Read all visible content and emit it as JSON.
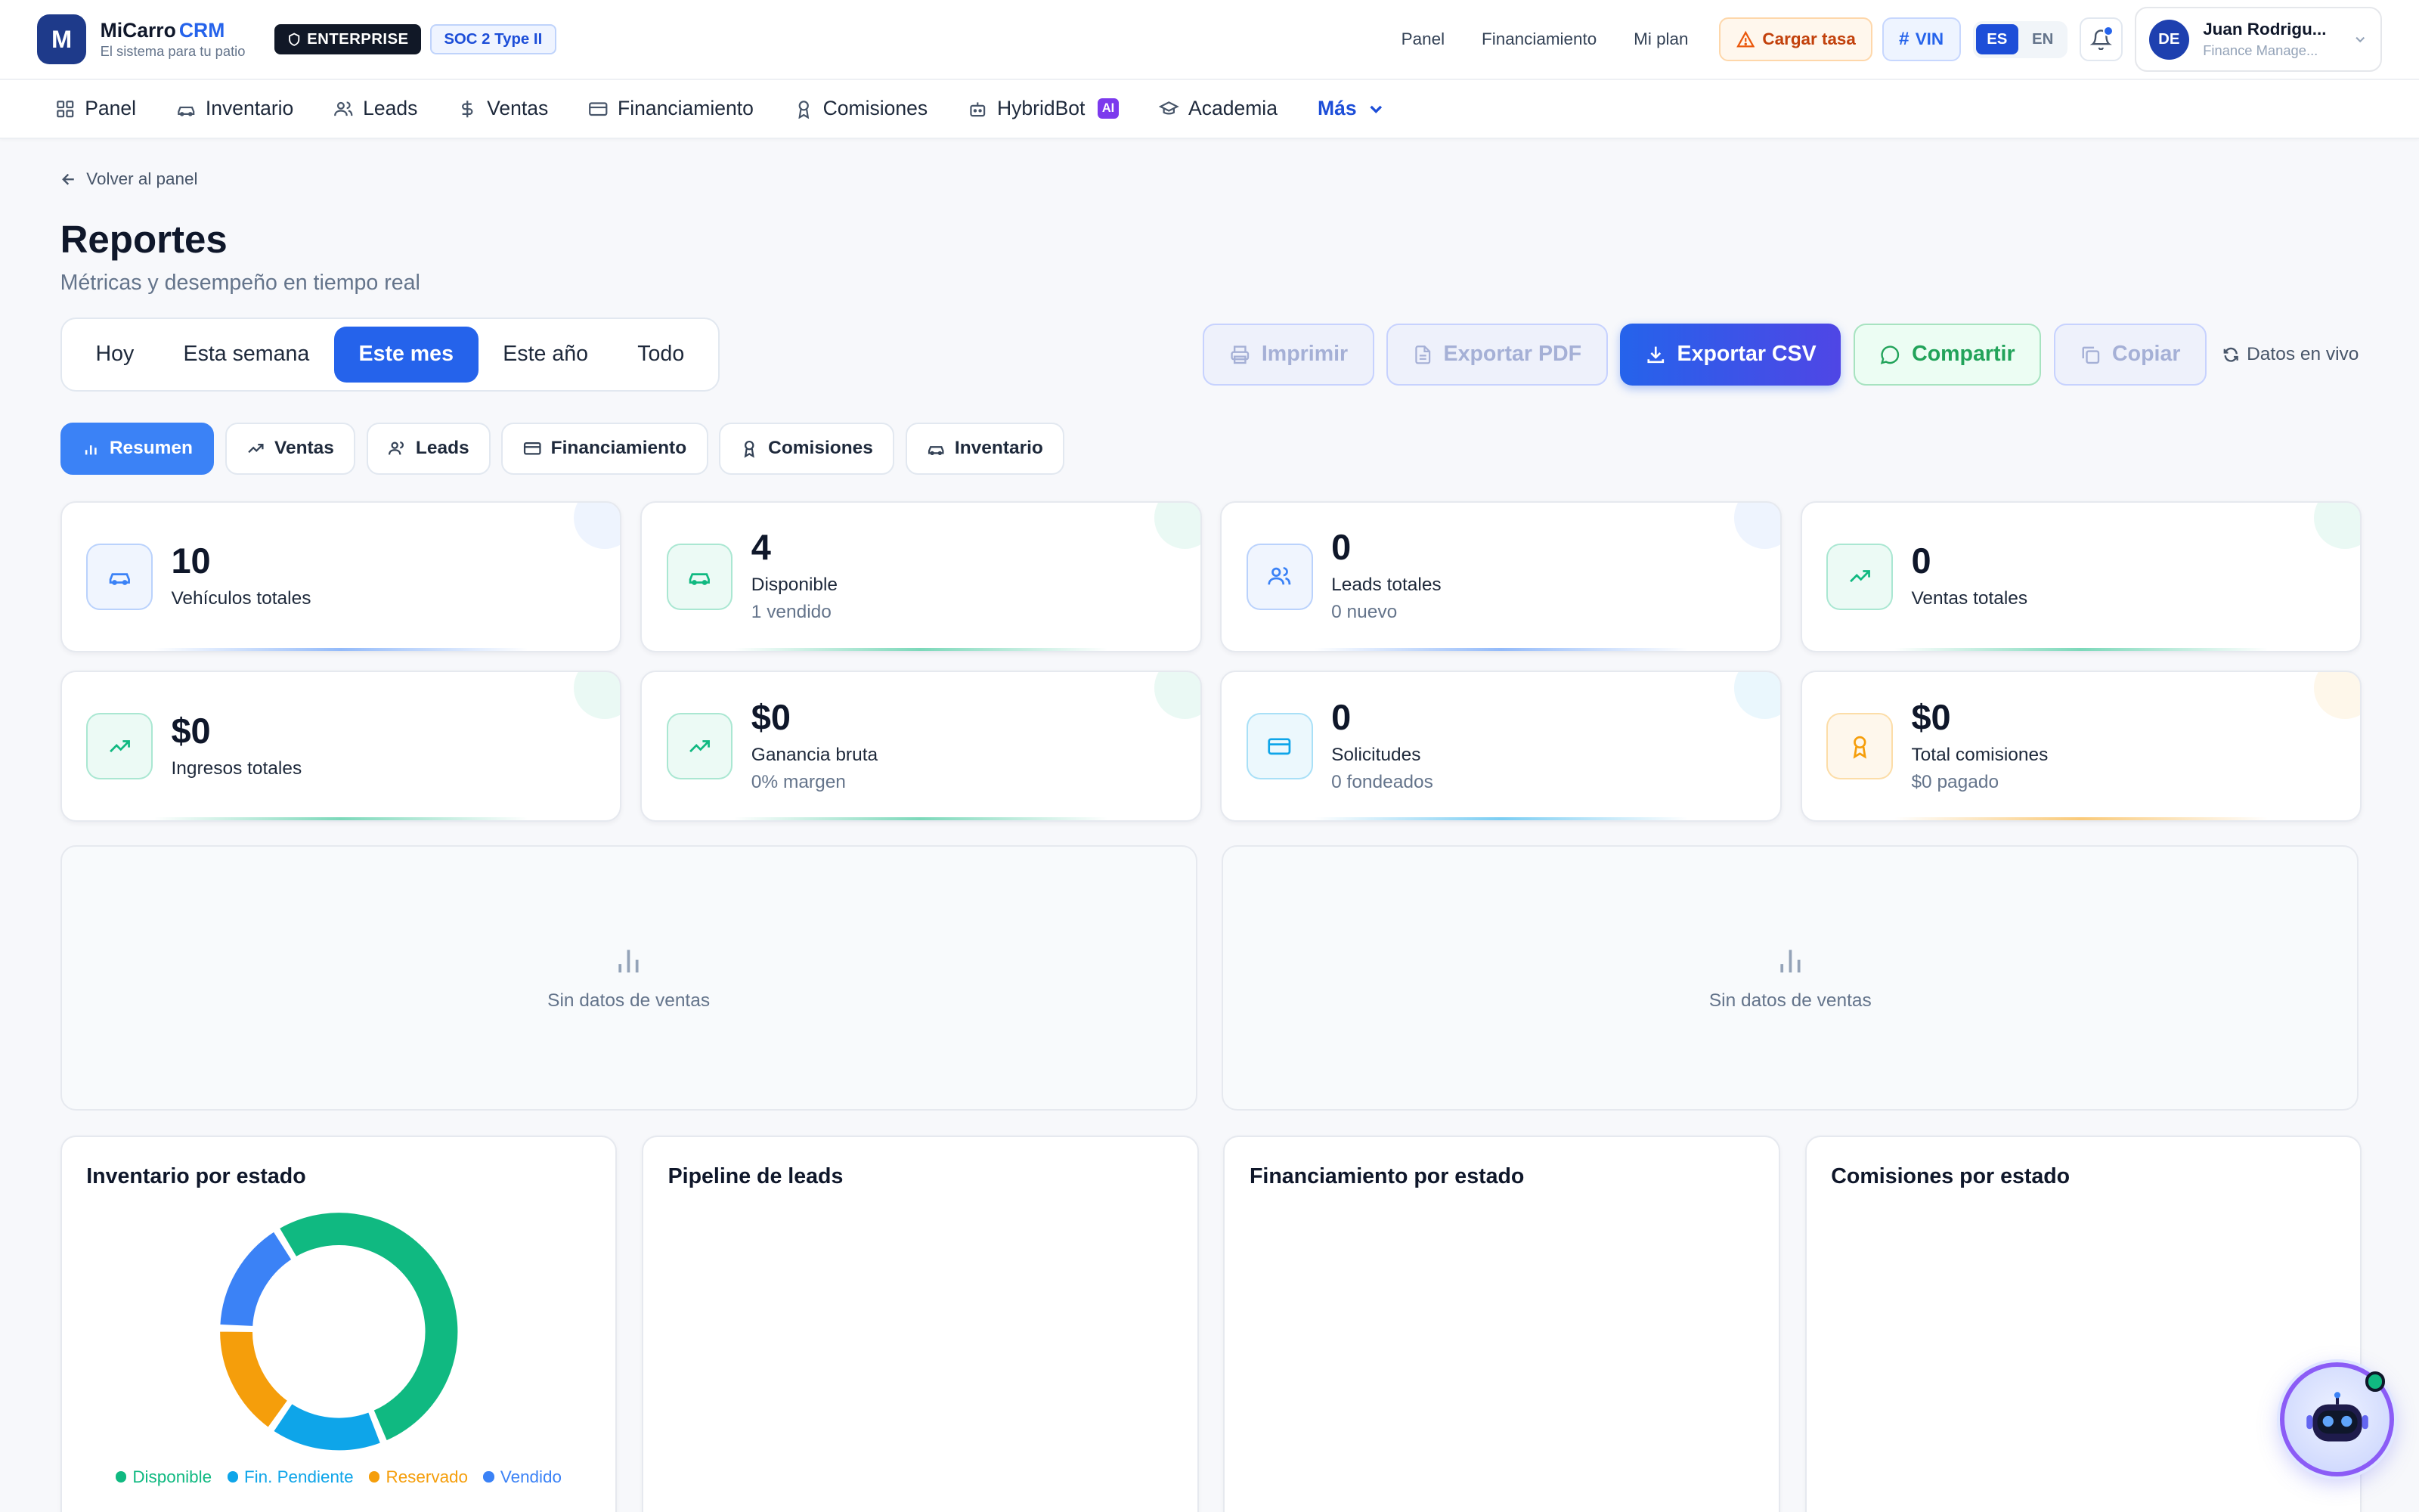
{
  "brand": {
    "logo_letter": "M",
    "name": "MiCarro",
    "name_suffix": "CRM",
    "tagline": "El sistema para tu patio",
    "badge_enterprise": "ENTERPRISE",
    "badge_compliance": "SOC 2 Type II"
  },
  "topbar": {
    "links": [
      "Panel",
      "Financiamiento",
      "Mi plan"
    ],
    "rate_button": "Cargar tasa",
    "vin_button": "VIN",
    "languages": [
      "ES",
      "EN"
    ],
    "active_language": "ES",
    "user": {
      "initials": "DE",
      "name": "Juan Rodrigu...",
      "role": "Finance Manage..."
    }
  },
  "nav": {
    "items": [
      {
        "label": "Panel",
        "icon": "grid-icon"
      },
      {
        "label": "Inventario",
        "icon": "car-icon"
      },
      {
        "label": "Leads",
        "icon": "users-icon"
      },
      {
        "label": "Ventas",
        "icon": "dollar-icon"
      },
      {
        "label": "Financiamiento",
        "icon": "card-icon"
      },
      {
        "label": "Comisiones",
        "icon": "award-icon"
      },
      {
        "label": "HybridBot",
        "icon": "bot-icon",
        "badge": "AI"
      },
      {
        "label": "Academia",
        "icon": "graduation-cap-icon"
      }
    ],
    "more": "Más"
  },
  "page": {
    "back": "Volver al panel",
    "title": "Reportes",
    "subtitle": "Métricas y desempeño en tiempo real"
  },
  "periods": [
    "Hoy",
    "Esta semana",
    "Este mes",
    "Este año",
    "Todo"
  ],
  "active_period": "Este mes",
  "actions": {
    "print": "Imprimir",
    "pdf": "Exportar PDF",
    "csv": "Exportar CSV",
    "share": "Compartir",
    "copy": "Copiar",
    "live": "Datos en vivo"
  },
  "tabs": [
    "Resumen",
    "Ventas",
    "Leads",
    "Financiamiento",
    "Comisiones",
    "Inventario"
  ],
  "active_tab": "Resumen",
  "kpis": [
    {
      "value": "10",
      "label": "Vehículos totales",
      "sub": "",
      "icon": "car-icon",
      "color": "#3b82f6"
    },
    {
      "value": "4",
      "label": "Disponible",
      "sub": "1 vendido",
      "icon": "car-icon",
      "color": "#10b981"
    },
    {
      "value": "0",
      "label": "Leads totales",
      "sub": "0 nuevo",
      "icon": "users-icon",
      "color": "#3b82f6"
    },
    {
      "value": "0",
      "label": "Ventas totales",
      "sub": "",
      "icon": "trend-up-icon",
      "color": "#10b981"
    },
    {
      "value": "$0",
      "label": "Ingresos totales",
      "sub": "",
      "icon": "trend-up-icon",
      "color": "#10b981"
    },
    {
      "value": "$0",
      "label": "Ganancia bruta",
      "sub": "0% margen",
      "icon": "trend-up-icon",
      "color": "#10b981"
    },
    {
      "value": "0",
      "label": "Solicitudes",
      "sub": "0 fondeados",
      "icon": "card-icon",
      "color": "#0ea5e9"
    },
    {
      "value": "$0",
      "label": "Total comisiones",
      "sub": "$0 pagado",
      "icon": "award-icon",
      "color": "#f59e0b"
    }
  ],
  "empty_charts": [
    "Sin datos de ventas",
    "Sin datos de ventas"
  ],
  "status_cards": {
    "inventory": "Inventario por estado",
    "leads": "Pipeline de leads",
    "financing": "Financiamiento por estado",
    "commissions": "Comisiones por estado"
  },
  "chart_data": {
    "type": "pie",
    "title": "Inventario por estado",
    "categories": [
      "Disponible",
      "Fin. Pendiente",
      "Reservado",
      "Vendido"
    ],
    "values": [
      5,
      1.5,
      1.5,
      1.5
    ],
    "colors": [
      "#10b981",
      "#0ea5e9",
      "#f59e0b",
      "#3b82f6"
    ],
    "donut": true,
    "legend": "bottom"
  }
}
